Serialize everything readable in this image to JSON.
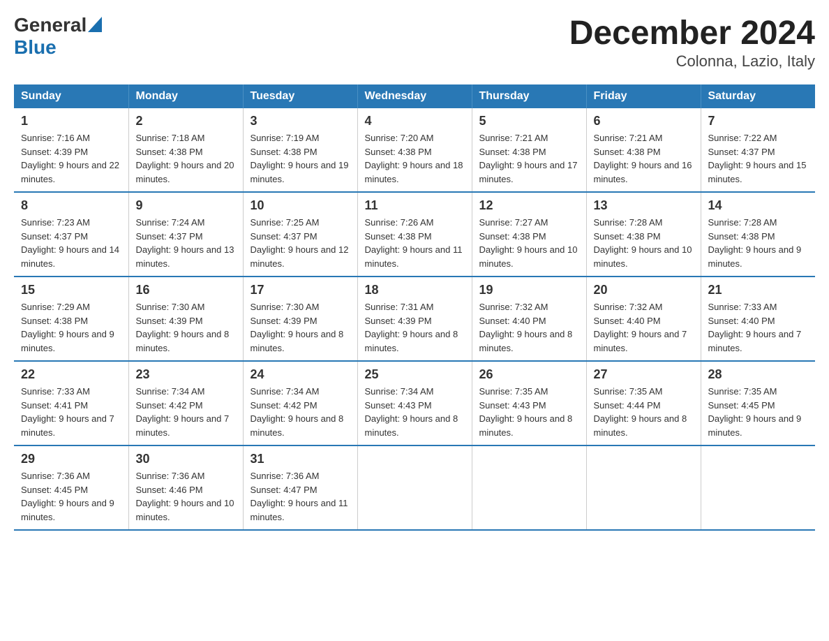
{
  "header": {
    "logo_general": "General",
    "logo_blue": "Blue",
    "title": "December 2024",
    "subtitle": "Colonna, Lazio, Italy"
  },
  "days_of_week": [
    "Sunday",
    "Monday",
    "Tuesday",
    "Wednesday",
    "Thursday",
    "Friday",
    "Saturday"
  ],
  "weeks": [
    [
      {
        "day": "1",
        "sunrise": "7:16 AM",
        "sunset": "4:39 PM",
        "daylight": "9 hours and 22 minutes."
      },
      {
        "day": "2",
        "sunrise": "7:18 AM",
        "sunset": "4:38 PM",
        "daylight": "9 hours and 20 minutes."
      },
      {
        "day": "3",
        "sunrise": "7:19 AM",
        "sunset": "4:38 PM",
        "daylight": "9 hours and 19 minutes."
      },
      {
        "day": "4",
        "sunrise": "7:20 AM",
        "sunset": "4:38 PM",
        "daylight": "9 hours and 18 minutes."
      },
      {
        "day": "5",
        "sunrise": "7:21 AM",
        "sunset": "4:38 PM",
        "daylight": "9 hours and 17 minutes."
      },
      {
        "day": "6",
        "sunrise": "7:21 AM",
        "sunset": "4:38 PM",
        "daylight": "9 hours and 16 minutes."
      },
      {
        "day": "7",
        "sunrise": "7:22 AM",
        "sunset": "4:37 PM",
        "daylight": "9 hours and 15 minutes."
      }
    ],
    [
      {
        "day": "8",
        "sunrise": "7:23 AM",
        "sunset": "4:37 PM",
        "daylight": "9 hours and 14 minutes."
      },
      {
        "day": "9",
        "sunrise": "7:24 AM",
        "sunset": "4:37 PM",
        "daylight": "9 hours and 13 minutes."
      },
      {
        "day": "10",
        "sunrise": "7:25 AM",
        "sunset": "4:37 PM",
        "daylight": "9 hours and 12 minutes."
      },
      {
        "day": "11",
        "sunrise": "7:26 AM",
        "sunset": "4:38 PM",
        "daylight": "9 hours and 11 minutes."
      },
      {
        "day": "12",
        "sunrise": "7:27 AM",
        "sunset": "4:38 PM",
        "daylight": "9 hours and 10 minutes."
      },
      {
        "day": "13",
        "sunrise": "7:28 AM",
        "sunset": "4:38 PM",
        "daylight": "9 hours and 10 minutes."
      },
      {
        "day": "14",
        "sunrise": "7:28 AM",
        "sunset": "4:38 PM",
        "daylight": "9 hours and 9 minutes."
      }
    ],
    [
      {
        "day": "15",
        "sunrise": "7:29 AM",
        "sunset": "4:38 PM",
        "daylight": "9 hours and 9 minutes."
      },
      {
        "day": "16",
        "sunrise": "7:30 AM",
        "sunset": "4:39 PM",
        "daylight": "9 hours and 8 minutes."
      },
      {
        "day": "17",
        "sunrise": "7:30 AM",
        "sunset": "4:39 PM",
        "daylight": "9 hours and 8 minutes."
      },
      {
        "day": "18",
        "sunrise": "7:31 AM",
        "sunset": "4:39 PM",
        "daylight": "9 hours and 8 minutes."
      },
      {
        "day": "19",
        "sunrise": "7:32 AM",
        "sunset": "4:40 PM",
        "daylight": "9 hours and 8 minutes."
      },
      {
        "day": "20",
        "sunrise": "7:32 AM",
        "sunset": "4:40 PM",
        "daylight": "9 hours and 7 minutes."
      },
      {
        "day": "21",
        "sunrise": "7:33 AM",
        "sunset": "4:40 PM",
        "daylight": "9 hours and 7 minutes."
      }
    ],
    [
      {
        "day": "22",
        "sunrise": "7:33 AM",
        "sunset": "4:41 PM",
        "daylight": "9 hours and 7 minutes."
      },
      {
        "day": "23",
        "sunrise": "7:34 AM",
        "sunset": "4:42 PM",
        "daylight": "9 hours and 7 minutes."
      },
      {
        "day": "24",
        "sunrise": "7:34 AM",
        "sunset": "4:42 PM",
        "daylight": "9 hours and 8 minutes."
      },
      {
        "day": "25",
        "sunrise": "7:34 AM",
        "sunset": "4:43 PM",
        "daylight": "9 hours and 8 minutes."
      },
      {
        "day": "26",
        "sunrise": "7:35 AM",
        "sunset": "4:43 PM",
        "daylight": "9 hours and 8 minutes."
      },
      {
        "day": "27",
        "sunrise": "7:35 AM",
        "sunset": "4:44 PM",
        "daylight": "9 hours and 8 minutes."
      },
      {
        "day": "28",
        "sunrise": "7:35 AM",
        "sunset": "4:45 PM",
        "daylight": "9 hours and 9 minutes."
      }
    ],
    [
      {
        "day": "29",
        "sunrise": "7:36 AM",
        "sunset": "4:45 PM",
        "daylight": "9 hours and 9 minutes."
      },
      {
        "day": "30",
        "sunrise": "7:36 AM",
        "sunset": "4:46 PM",
        "daylight": "9 hours and 10 minutes."
      },
      {
        "day": "31",
        "sunrise": "7:36 AM",
        "sunset": "4:47 PM",
        "daylight": "9 hours and 11 minutes."
      },
      null,
      null,
      null,
      null
    ]
  ]
}
